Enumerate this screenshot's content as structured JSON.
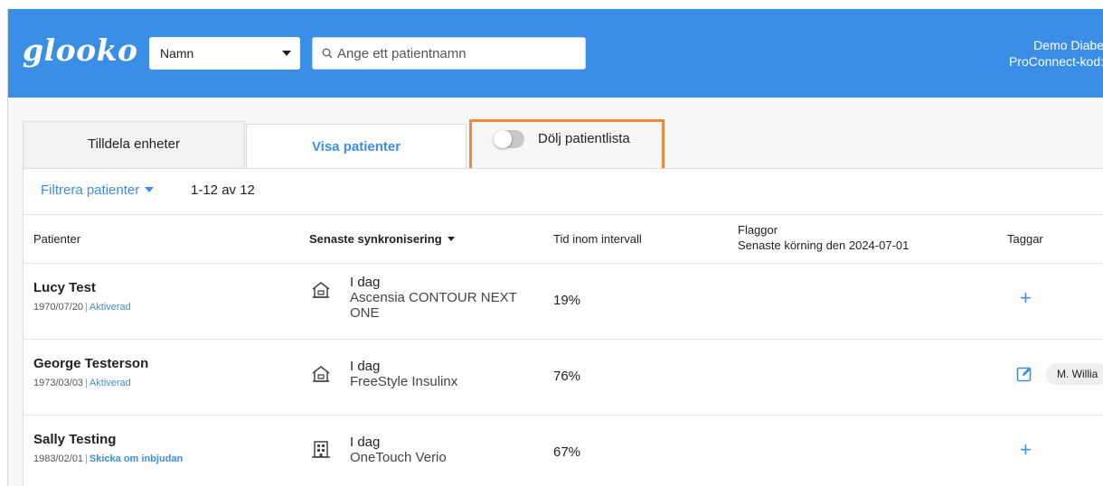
{
  "header": {
    "logo": "glooko",
    "search_type": "Namn",
    "search_placeholder": "Ange ett patientnamn",
    "account_name": "Demo Diabe",
    "proconnect_label": "ProConnect-kod:"
  },
  "tabs": [
    {
      "label": "Tilldela enheter",
      "active": false
    },
    {
      "label": "Visa patienter",
      "active": true
    }
  ],
  "toggle": {
    "label": "Dölj patientlista",
    "on": false
  },
  "filter": {
    "label": "Filtrera patienter",
    "range": "1-12 av 12"
  },
  "table": {
    "headers": {
      "patients": "Patienter",
      "last_sync": "Senaste synkronisering",
      "time_in_range": "Tid inom intervall",
      "flags": "Flaggor",
      "flags_sub": "Senaste körning den 2024-07-01",
      "tags": "Taggar"
    },
    "rows": [
      {
        "name": "Lucy Test",
        "dob": "1970/07/20",
        "separator": "|",
        "status": "Aktiverad",
        "sync_day": "I dag",
        "device_line1": "Ascensia CONTOUR NEXT",
        "device_line2": "ONE",
        "device_icon": "home-icon",
        "tir": "19%",
        "tag_action": "+",
        "tag": ""
      },
      {
        "name": "George Testerson",
        "dob": "1973/03/03",
        "separator": "|",
        "status": "Aktiverad",
        "sync_day": "I dag",
        "device_line1": "FreeStyle Insulinx",
        "device_line2": "",
        "device_icon": "home-icon",
        "tir": "76%",
        "tag_action": "",
        "tag": "M. Willia"
      },
      {
        "name": "Sally Testing",
        "dob": "1983/02/01",
        "separator": "|",
        "status": "Skicka om inbjudan",
        "sync_day": "I dag",
        "device_line1": "OneTouch Verio",
        "device_line2": "",
        "device_icon": "clinic-building-icon",
        "tir": "67%",
        "tag_action": "+",
        "tag": ""
      }
    ]
  },
  "colors": {
    "brand_blue": "#3b8ee6",
    "highlight_orange": "#f08a37"
  }
}
